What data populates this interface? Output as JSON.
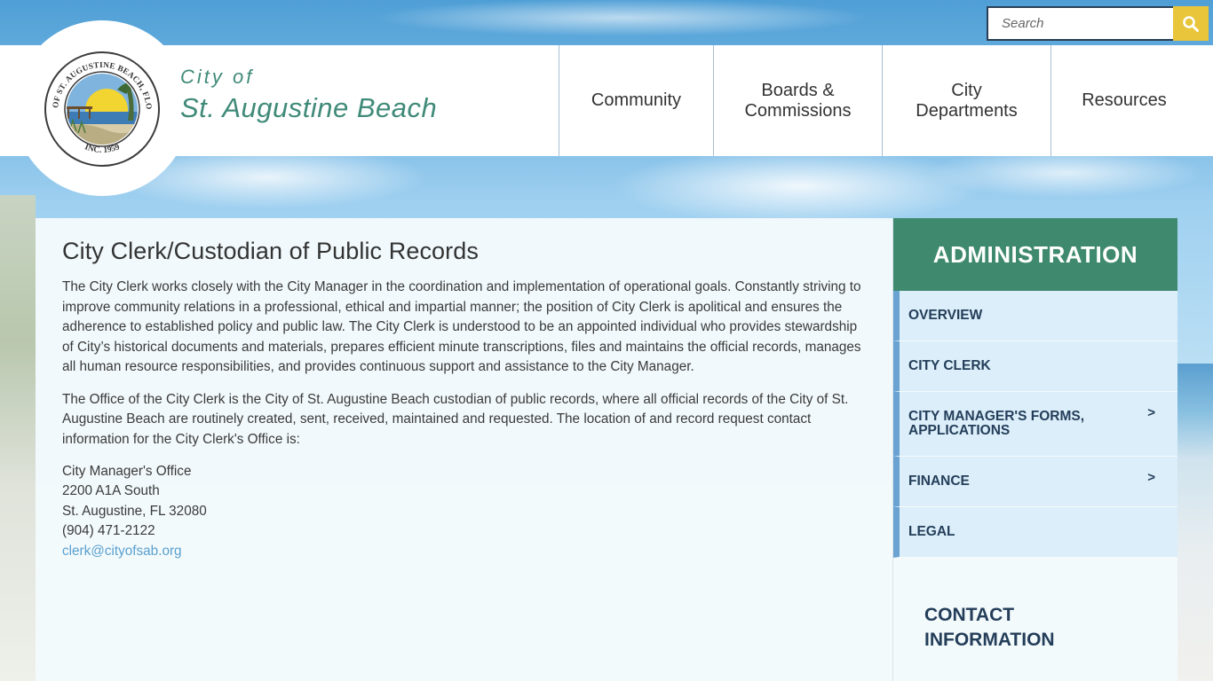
{
  "search": {
    "placeholder": "Search"
  },
  "brand": {
    "line1": "City of",
    "line2": "St. Augustine Beach"
  },
  "seal": {
    "top_text": "CITY OF ST. AUGUSTINE BEACH, FLORIDA",
    "bottom_text": "INC. 1959"
  },
  "nav": [
    {
      "label_line1": "Community",
      "label_line2": ""
    },
    {
      "label_line1": "Boards &",
      "label_line2": "Commissions"
    },
    {
      "label_line1": "City",
      "label_line2": "Departments"
    },
    {
      "label_line1": "Resources",
      "label_line2": ""
    }
  ],
  "main": {
    "title": "City Clerk/Custodian of Public Records",
    "paragraph1": "The City Clerk works closely with the City Manager in the coordination and implementation of operational goals. Constantly striving to improve community relations in a professional, ethical and impartial manner; the position of City Clerk is apolitical and ensures the adherence to established policy and public law. The City Clerk is understood to be an appointed individual who provides stewardship of City’s historical documents and materials, prepares efficient minute transcriptions, files and maintains the official records, manages all human resource responsibilities, and provides continuous support and assistance to the City Manager.",
    "paragraph2": "The Office of the City Clerk is the City of St. Augustine Beach custodian of public records, where all official records of the City of St. Augustine Beach are routinely created, sent, received, maintained and requested. The location of and record request contact information for the City Clerk's Office is:",
    "address": {
      "office": "City Manager's Office",
      "street": "2200 A1A South",
      "city": "St. Augustine, FL 32080",
      "phone": "(904) 471-2122",
      "email": "clerk@cityofsab.org"
    }
  },
  "sidebar": {
    "title": "ADMINISTRATION",
    "items": [
      {
        "label": "OVERVIEW",
        "chevron": ""
      },
      {
        "label": "CITY CLERK",
        "chevron": ""
      },
      {
        "label": "CITY MANAGER'S FORMS, APPLICATIONS",
        "chevron": ">"
      },
      {
        "label": "FINANCE",
        "chevron": ">"
      },
      {
        "label": "LEGAL",
        "chevron": ""
      }
    ],
    "contact_line1": "CONTACT",
    "contact_line2": "INFORMATION"
  },
  "colors": {
    "accent_green": "#3f8a6e",
    "search_button": "#e8c53a",
    "nav_text": "#333333",
    "sidebar_item_bg": "#dbeef9",
    "sidebar_text": "#243e5a"
  },
  "icons": {
    "search_button": "search-icon"
  }
}
